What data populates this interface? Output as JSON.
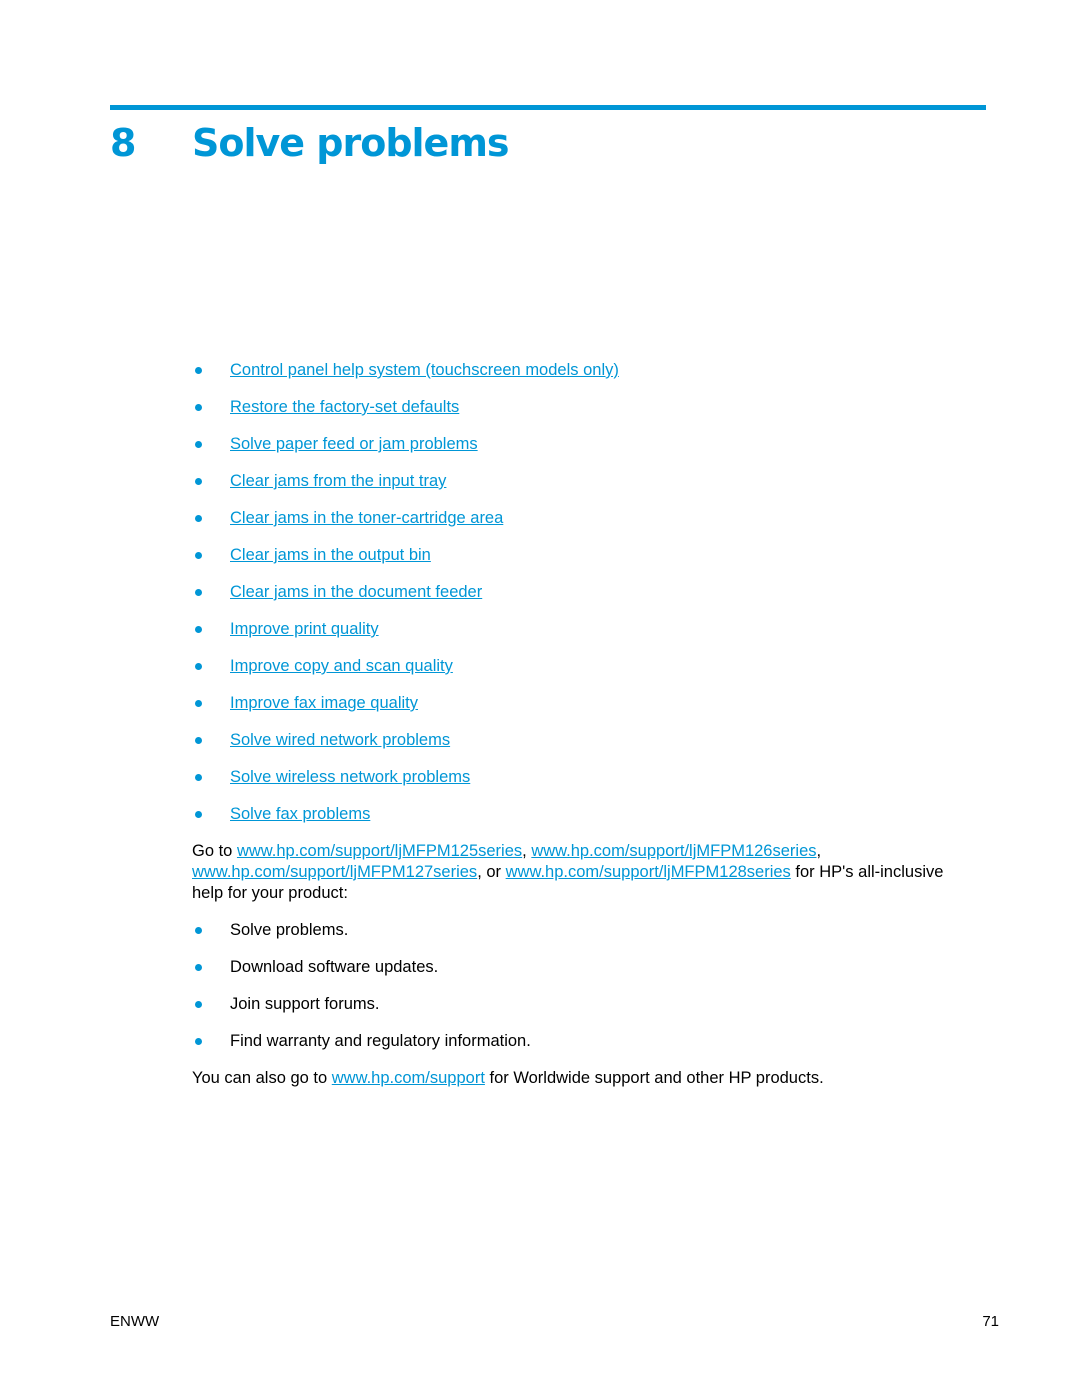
{
  "header": {
    "chapter_number": "8",
    "chapter_title": "Solve problems",
    "accent_color": "#0096d6"
  },
  "toc_links": [
    {
      "label": "Control panel help system (touchscreen models only)"
    },
    {
      "label": "Restore the factory-set defaults"
    },
    {
      "label": "Solve paper feed or jam problems"
    },
    {
      "label": "Clear jams from the input tray"
    },
    {
      "label": "Clear jams in the toner-cartridge area"
    },
    {
      "label": "Clear jams in the output bin"
    },
    {
      "label": "Clear jams in the document feeder"
    },
    {
      "label": "Improve print quality"
    },
    {
      "label": "Improve copy and scan quality"
    },
    {
      "label": "Improve fax image quality"
    },
    {
      "label": "Solve wired network problems"
    },
    {
      "label": "Solve wireless network problems"
    },
    {
      "label": "Solve fax problems"
    }
  ],
  "goto_paragraph": {
    "prefix": "Go to ",
    "link1": "www.hp.com/support/ljMFPM125series",
    "sep1": ", ",
    "link2": "www.hp.com/support/ljMFPM126series",
    "sep2": ", ",
    "link3": "www.hp.com/support/ljMFPM127series",
    "sep3": ", or ",
    "link4": "www.hp.com/support/ljMFPM128series",
    "suffix": " for HP's all-inclusive help for your product:"
  },
  "support_items": [
    {
      "label": "Solve problems."
    },
    {
      "label": "Download software updates."
    },
    {
      "label": "Join support forums."
    },
    {
      "label": "Find warranty and regulatory information."
    }
  ],
  "also_paragraph": {
    "prefix": "You can also go to ",
    "link": "www.hp.com/support",
    "suffix": " for Worldwide support and other HP products."
  },
  "footer": {
    "left": "ENWW",
    "page_number": "71"
  }
}
